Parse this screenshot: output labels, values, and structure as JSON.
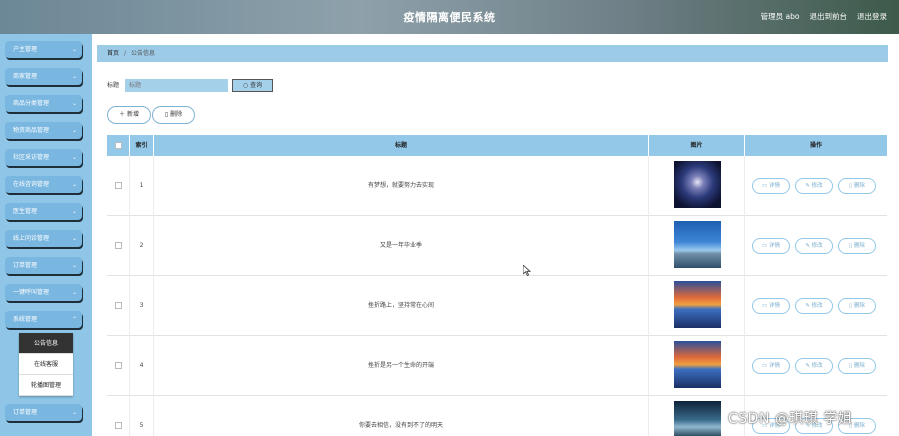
{
  "header": {
    "title": "疫情隔离便民系统",
    "admin": "管理员 abo",
    "back": "退出到前台",
    "logout": "退出登录"
  },
  "sidebar": {
    "items": [
      {
        "label": "户主管理"
      },
      {
        "label": "商家管理"
      },
      {
        "label": "商品分类管理"
      },
      {
        "label": "物资商品管理"
      },
      {
        "label": "社区采访管理"
      },
      {
        "label": "在线咨询管理"
      },
      {
        "label": "医生管理"
      },
      {
        "label": "线上问诊管理"
      },
      {
        "label": "订单管理"
      },
      {
        "label": "一键呼叫管理"
      },
      {
        "label": "系统管理"
      },
      {
        "label": "订单管理"
      }
    ],
    "submenu": [
      {
        "label": "公告信息"
      },
      {
        "label": "在线客服"
      },
      {
        "label": "轮播图管理"
      }
    ]
  },
  "breadcrumb": {
    "home": "首页",
    "sep": "/",
    "current": "公告信息"
  },
  "search": {
    "label": "标题",
    "placeholder": "标题",
    "button": "查询"
  },
  "actions": {
    "add": "新增",
    "delete": "删除"
  },
  "table": {
    "headers": {
      "index": "索引",
      "title": "标题",
      "image": "图片",
      "ops": "操作"
    },
    "op_labels": {
      "detail": "详情",
      "edit": "修改",
      "delete": "删除"
    },
    "rows": [
      {
        "index": "1",
        "title": "有梦想，就要努力去实现"
      },
      {
        "index": "2",
        "title": "又是一年毕业季"
      },
      {
        "index": "3",
        "title": "挫折路上，坚持常在心间"
      },
      {
        "index": "4",
        "title": "挫折是另一个生命的开端"
      },
      {
        "index": "5",
        "title": "你要去相信，没有到不了的明天"
      }
    ]
  },
  "watermark": "CSDN @琪琪 学姐",
  "colors": {
    "sidebar_bg": "#8fc6e8",
    "menu_btn": "#79b6e0",
    "table_header": "#93c8e9"
  }
}
